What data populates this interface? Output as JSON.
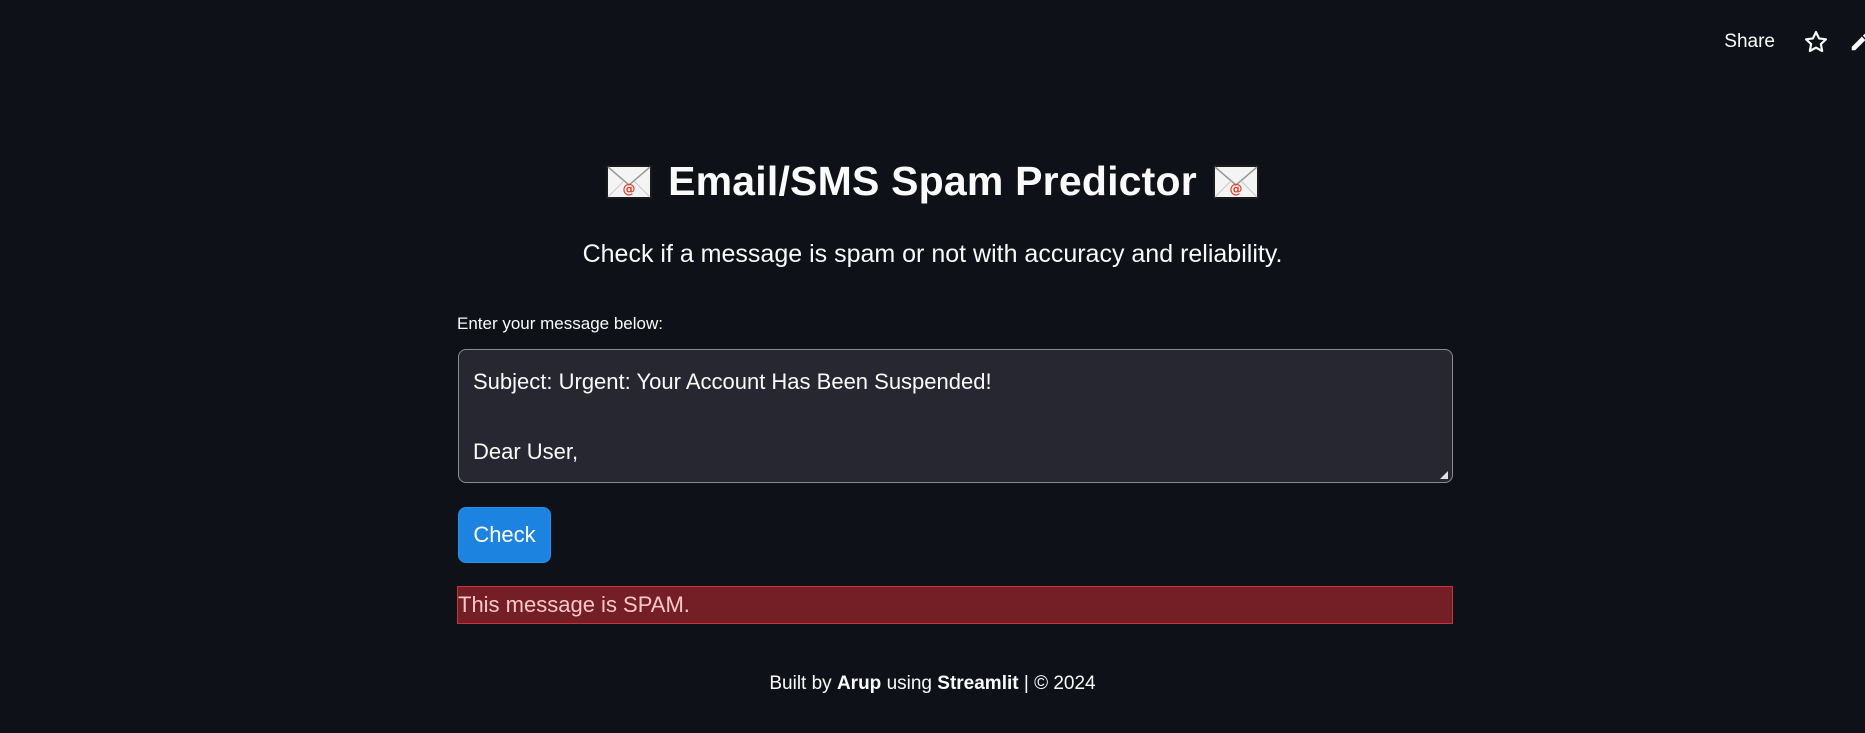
{
  "toolbar": {
    "share_label": "Share",
    "star_icon": "star-icon",
    "edit_icon": "pencil-icon"
  },
  "header": {
    "title": "Email/SMS Spam Predictor",
    "title_icon": "envelope-icon",
    "subtitle": "Check if a message is spam or not with accuracy and reliability."
  },
  "form": {
    "label": "Enter your message below:",
    "message_lines": [
      "Subject: Urgent: Your Account Has Been Suspended!",
      "",
      "Dear User,"
    ],
    "button_label": "Check"
  },
  "result": {
    "text": "This message is SPAM.",
    "color": "#731f25"
  },
  "footer": {
    "prefix": "Built by",
    "author": "Arup",
    "middle": "using",
    "tool": "Streamlit",
    "suffix": "| © 2024"
  },
  "colors": {
    "background": "#0e1117",
    "accent": "#1c83e1",
    "input_bg": "#262730"
  }
}
